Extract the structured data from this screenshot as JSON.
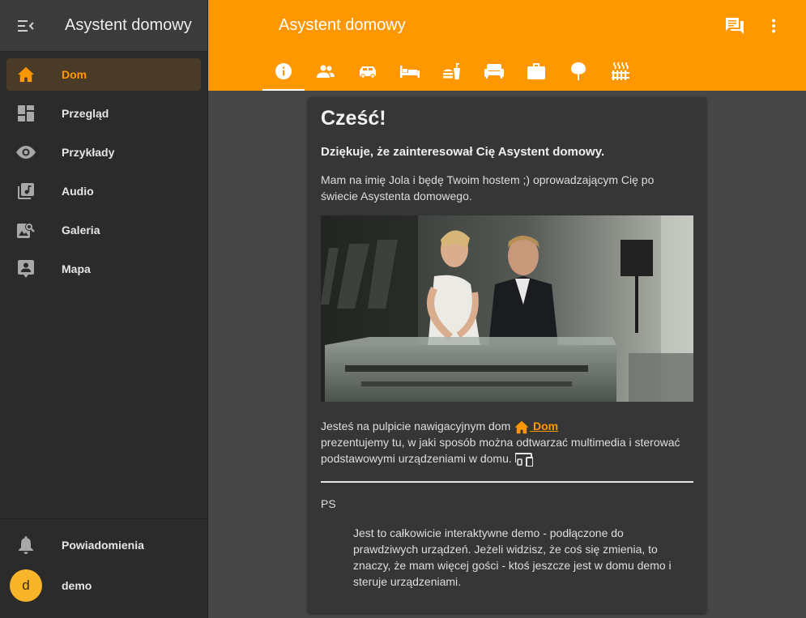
{
  "sidebar": {
    "title": "Asystent domowy",
    "items": [
      {
        "label": "Dom",
        "icon": "home-icon",
        "active": true
      },
      {
        "label": "Przegląd",
        "icon": "dashboard-icon"
      },
      {
        "label": "Przykłady",
        "icon": "eye-icon"
      },
      {
        "label": "Audio",
        "icon": "library-music-icon"
      },
      {
        "label": "Galeria",
        "icon": "image-search-icon"
      },
      {
        "label": "Mapa",
        "icon": "account-box-icon"
      }
    ],
    "notifications_label": "Powiadomienia",
    "user": {
      "initial": "d",
      "name": "demo"
    }
  },
  "toolbar": {
    "title": "Asystent domowy",
    "actions": [
      "conversation-icon",
      "more-vertical-icon"
    ],
    "tabs": [
      {
        "icon": "information-icon",
        "active": true
      },
      {
        "icon": "people-icon"
      },
      {
        "icon": "car-icon"
      },
      {
        "icon": "bed-icon"
      },
      {
        "icon": "food-drink-icon"
      },
      {
        "icon": "sofa-icon"
      },
      {
        "icon": "briefcase-icon"
      },
      {
        "icon": "tree-icon"
      },
      {
        "icon": "radiator-icon"
      }
    ]
  },
  "card": {
    "heading": "Cześć!",
    "subheading": "Dziękuje, że zainteresował Cię Asystent domowy.",
    "intro": "Mam na imię Jola i będę Twoim hostem ;) oprowadzającym Cię po świecie Asystenta domowego.",
    "nav_text_before": "Jesteś na pulpicie nawigacyjnym dom ",
    "nav_link": " Dom",
    "nav_text_after": "prezentujemy tu, w jaki sposób można odtwarzać multimedia i sterować podstawowymi urządzeniami w domu. ",
    "ps_label": "PS",
    "quote": "Jest to całkowicie interaktywne demo - podłączone do prawdziwych urządzeń. Jeżeli widzisz, że coś się zmienia, to znaczy, że mam więcej gości - ktoś jeszcze jest w domu demo i steruje urządzeniami."
  },
  "colors": {
    "accent": "#ff9800",
    "sidebar_bg": "#2b2b2b",
    "card_bg": "#363636",
    "page_bg": "#464646"
  }
}
